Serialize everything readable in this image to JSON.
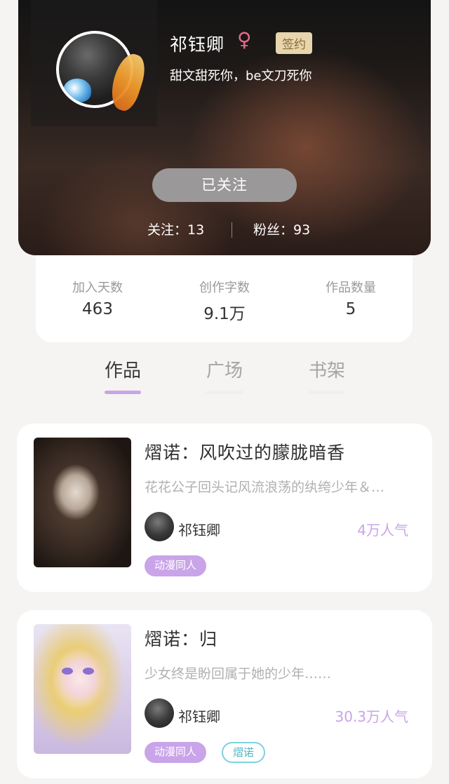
{
  "profile": {
    "name": "祁钰卿",
    "gender_icon": "female-icon",
    "gender_symbol": "♀",
    "signed_badge": "签约",
    "bio": "甜文甜死你，be文刀死你",
    "follow_button": "已关注",
    "following_text": "关注：13",
    "fans_text": "粉丝：93"
  },
  "stats": [
    {
      "label": "加入天数",
      "value": "463"
    },
    {
      "label": "创作字数",
      "value": "9.1万"
    },
    {
      "label": "作品数量",
      "value": "5"
    }
  ],
  "tabs": [
    {
      "label": "作品",
      "active": true
    },
    {
      "label": "广场",
      "active": false
    },
    {
      "label": "书架",
      "active": false
    }
  ],
  "works": [
    {
      "title": "熠诺：风吹过的朦胧暗香",
      "summary": "花花公子回头记风流浪荡的纨绔少年＆…",
      "author": "祁钰卿",
      "popularity": "4万人气",
      "tags": [
        "动漫同人"
      ]
    },
    {
      "title": "熠诺：归",
      "summary": "少女终是盼回属于她的少年……",
      "author": "祁钰卿",
      "popularity": "30.3万人气",
      "tags": [
        "动漫同人",
        "熠诺"
      ]
    }
  ],
  "colors": {
    "accent": "#c9a4e8",
    "tag_outline": "#7fd1dd",
    "badge_bg": "#e6d5ad",
    "follow_btn": "#9a9898"
  }
}
